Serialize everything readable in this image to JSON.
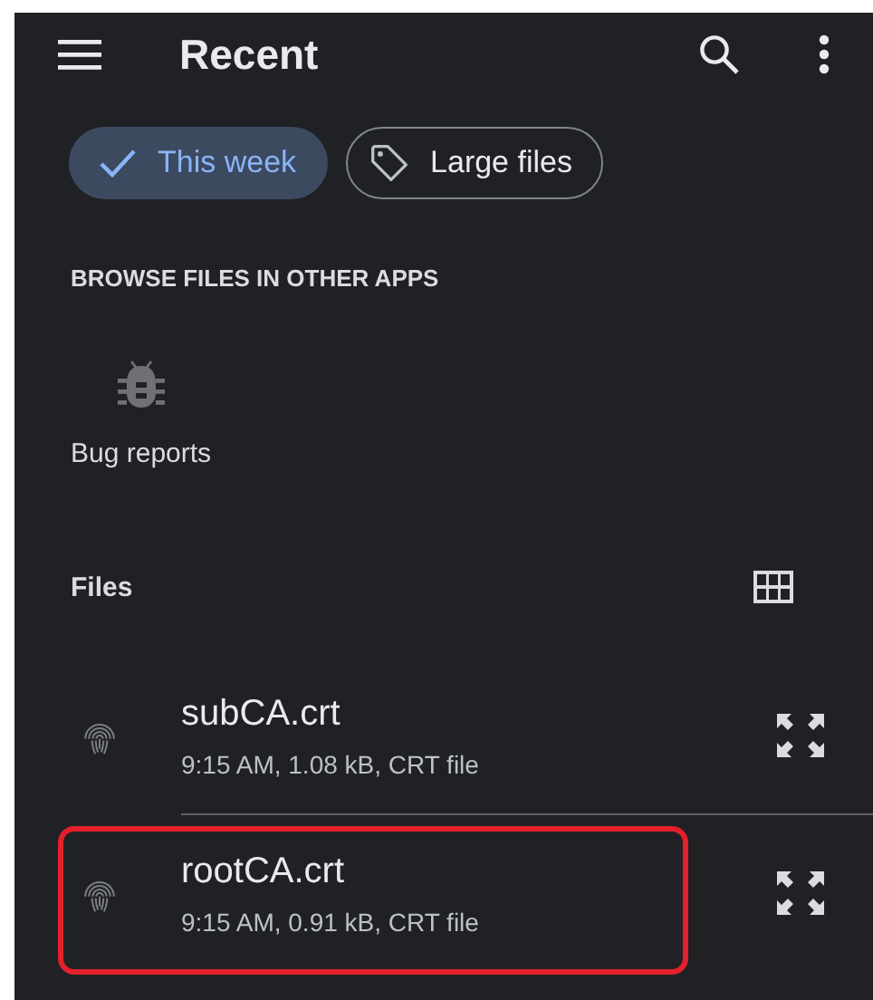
{
  "app_bar": {
    "title": "Recent"
  },
  "chips": [
    {
      "label": "This week",
      "kind": "check",
      "selected": true
    },
    {
      "label": "Large files",
      "kind": "tag",
      "selected": false
    }
  ],
  "browse_section": {
    "heading": "BROWSE FILES IN OTHER APPS",
    "apps": [
      {
        "label": "Bug reports"
      }
    ]
  },
  "files_section": {
    "heading": "Files",
    "files": [
      {
        "name": "subCA.crt",
        "details": "9:15 AM, 1.08 kB, CRT file",
        "highlighted": false
      },
      {
        "name": "rootCA.crt",
        "details": "9:15 AM, 0.91 kB, CRT file",
        "highlighted": true
      }
    ]
  }
}
